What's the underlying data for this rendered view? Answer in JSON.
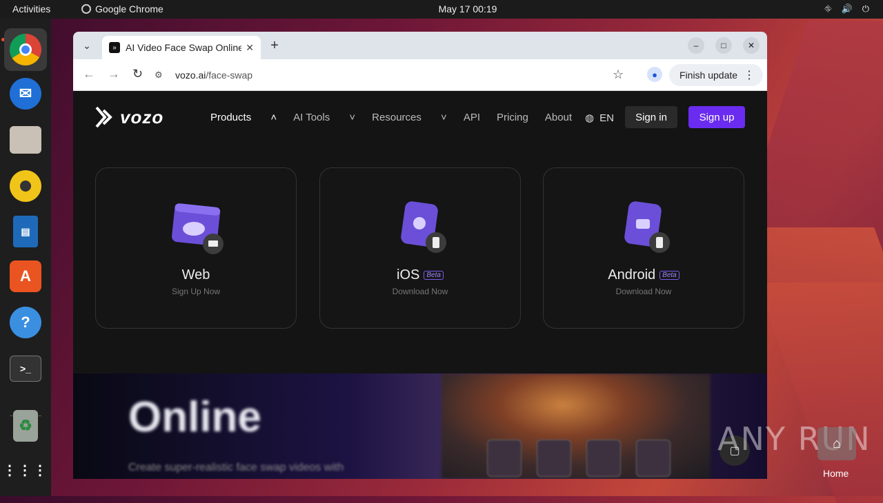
{
  "topbar": {
    "activities": "Activities",
    "app_name": "Google Chrome",
    "clock": "May 17  00:19"
  },
  "dock": {
    "items": [
      "Google Chrome",
      "Thunderbird",
      "Files",
      "Rhythmbox",
      "LibreOffice Writer",
      "Ubuntu Software",
      "Help",
      "Terminal",
      "Trash",
      "Show Applications"
    ]
  },
  "browser": {
    "tab_title": "AI Video Face Swap Online",
    "url_host": "vozo.ai",
    "url_path": "/face-swap",
    "update_label": "Finish update"
  },
  "site": {
    "logo_text": "vozo",
    "nav": [
      "Products",
      "AI Tools",
      "Resources",
      "API",
      "Pricing",
      "About"
    ],
    "lang": "EN",
    "signin": "Sign in",
    "signup": "Sign up",
    "cards": [
      {
        "name": "Web",
        "sub": "Sign Up Now",
        "badge": ""
      },
      {
        "name": "iOS",
        "sub": "Download Now",
        "badge": "Beta"
      },
      {
        "name": "Android",
        "sub": "Download Now",
        "badge": "Beta"
      }
    ],
    "hero_word": "Online",
    "hero_line": "Create super-realistic face swap videos with"
  },
  "desktop": {
    "watermark": "ANY RUN",
    "home_label": "Home"
  },
  "colors": {
    "accent": "#6a2cf0",
    "ubuntu_orange": "#e95420"
  }
}
